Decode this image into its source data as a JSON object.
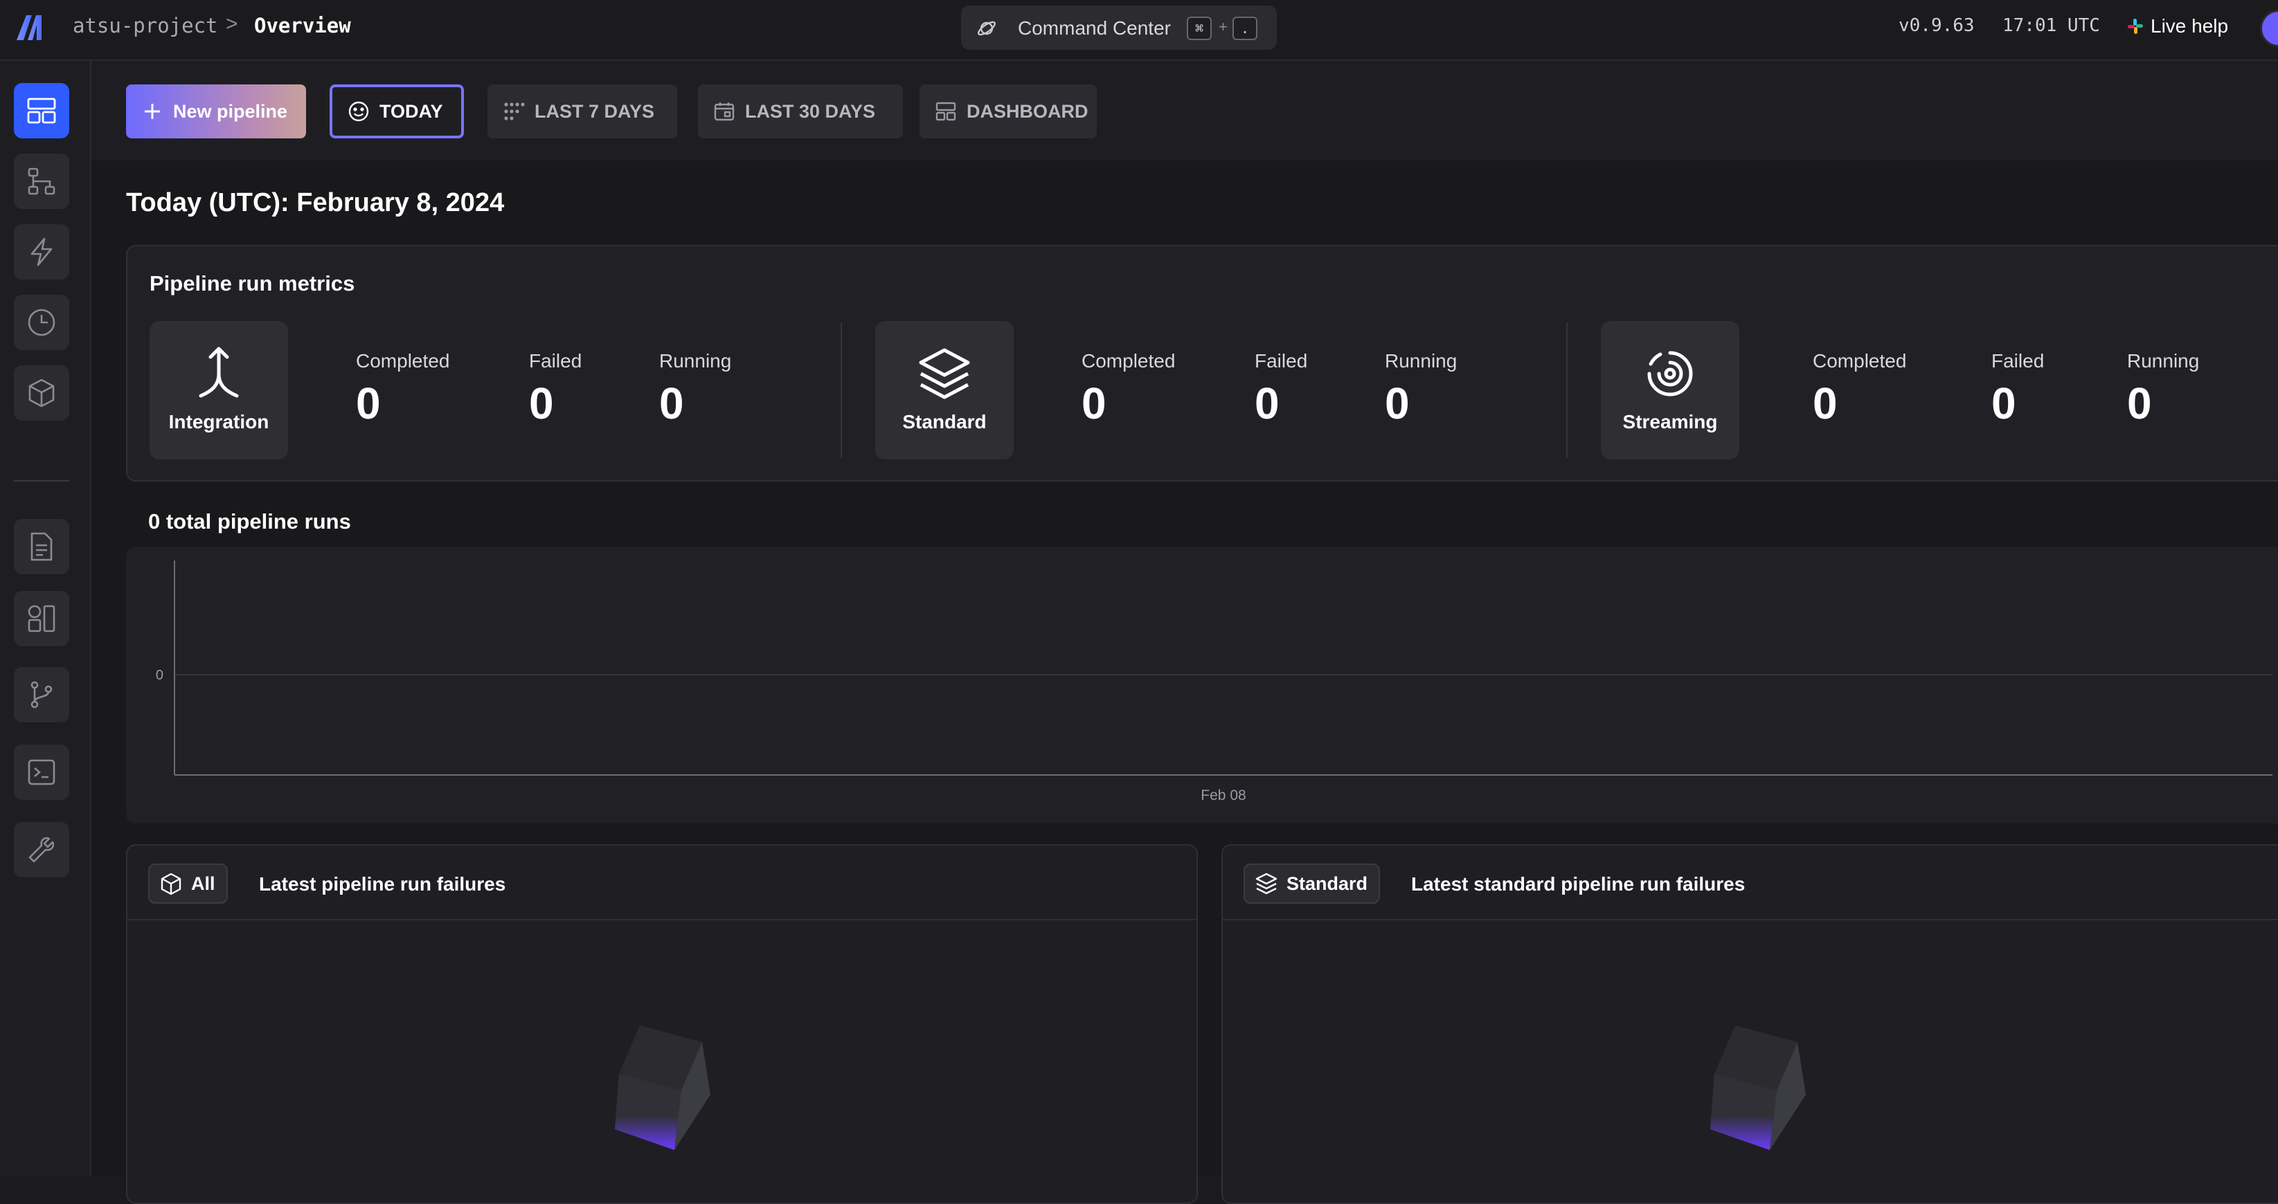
{
  "header": {
    "project": "atsu-project",
    "separator": ">",
    "page": "Overview",
    "command_center": {
      "label": "Command Center",
      "key1": "⌘",
      "plus": "+",
      "key2": "."
    },
    "version": "v0.9.63",
    "time": "17:01 UTC",
    "live_help": "Live help"
  },
  "sidebar": {
    "items": [
      {
        "icon": "overview-icon",
        "active": true
      },
      {
        "icon": "pipelines-icon"
      },
      {
        "icon": "triggers-icon"
      },
      {
        "icon": "runs-clock-icon"
      },
      {
        "icon": "cube-icon"
      },
      {
        "icon": "file-icon"
      },
      {
        "icon": "blocks-icon"
      },
      {
        "icon": "git-branch-icon"
      },
      {
        "icon": "terminal-icon"
      },
      {
        "icon": "wrench-icon"
      }
    ]
  },
  "toolbar": {
    "new_pipeline": "New pipeline",
    "today": "TODAY",
    "last7": "LAST 7 DAYS",
    "last30": "LAST 30 DAYS",
    "dashboard": "DASHBOARD"
  },
  "date_title": "Today (UTC): February 8, 2024",
  "metrics": {
    "title": "Pipeline run metrics",
    "groups": [
      {
        "type": "Integration",
        "completed_label": "Completed",
        "completed": "0",
        "failed_label": "Failed",
        "failed": "0",
        "running_label": "Running",
        "running": "0"
      },
      {
        "type": "Standard",
        "completed_label": "Completed",
        "completed": "0",
        "failed_label": "Failed",
        "failed": "0",
        "running_label": "Running",
        "running": "0"
      },
      {
        "type": "Streaming",
        "completed_label": "Completed",
        "completed": "0",
        "failed_label": "Failed",
        "failed": "0",
        "running_label": "Running",
        "running": "0"
      }
    ]
  },
  "runs": {
    "title": "0 total pipeline runs"
  },
  "chart_data": {
    "type": "bar",
    "title": "0 total pipeline runs",
    "categories": [
      "Feb 08"
    ],
    "values": [
      0
    ],
    "yticks": [
      "0"
    ],
    "ylim": [
      0,
      0
    ],
    "grid": true
  },
  "failures": {
    "all": {
      "chip": "All",
      "title": "Latest pipeline run failures"
    },
    "standard": {
      "chip": "Standard",
      "title": "Latest standard pipeline run failures"
    }
  },
  "colors": {
    "accent": "#2f5bff",
    "today_border": "#7b74ff",
    "background": "#19191c"
  }
}
